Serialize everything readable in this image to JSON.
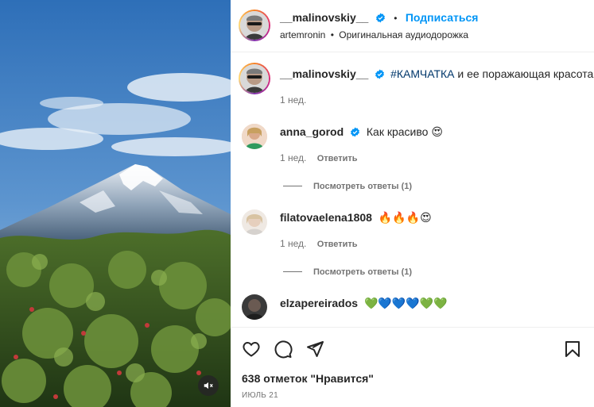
{
  "header": {
    "username": "__malinovskiy__",
    "separator": "•",
    "follow_label": "Подписаться",
    "audio_user": "artemronin",
    "audio_sep": "•",
    "audio_label": "Оригинальная аудиодорожка"
  },
  "caption": {
    "username": "__malinovskiy__",
    "hashtag": "#КАМЧАТКА",
    "text": " и ее поражающая красота",
    "emoji": "❤️",
    "time": "1 нед."
  },
  "comments": [
    {
      "username": "anna_gorod",
      "verified": true,
      "text": "Как красиво 😍",
      "time": "1 нед.",
      "reply_label": "Ответить",
      "view_replies": "Посмотреть ответы (1)"
    },
    {
      "username": "filatovaelena1808",
      "verified": false,
      "text": "🔥🔥🔥😍",
      "time": "1 нед.",
      "reply_label": "Ответить",
      "view_replies": "Посмотреть ответы (1)"
    },
    {
      "username": "elzapereirados",
      "verified": false,
      "text": "💚💙💙💙💚💚"
    }
  ],
  "footer": {
    "likes": "638 отметок \"Нравится\"",
    "date": "ИЮЛЬ 21"
  },
  "icons": {
    "like": "heart-outline-icon",
    "comment": "comment-icon",
    "share": "share-icon",
    "save": "bookmark-icon",
    "mute": "speaker-muted-icon",
    "verified": "verified-badge-icon"
  },
  "colors": {
    "accent": "#0095f6",
    "verified": "#0095f6",
    "hashtag": "#00376b",
    "muted": "#737373",
    "text": "#262626"
  }
}
